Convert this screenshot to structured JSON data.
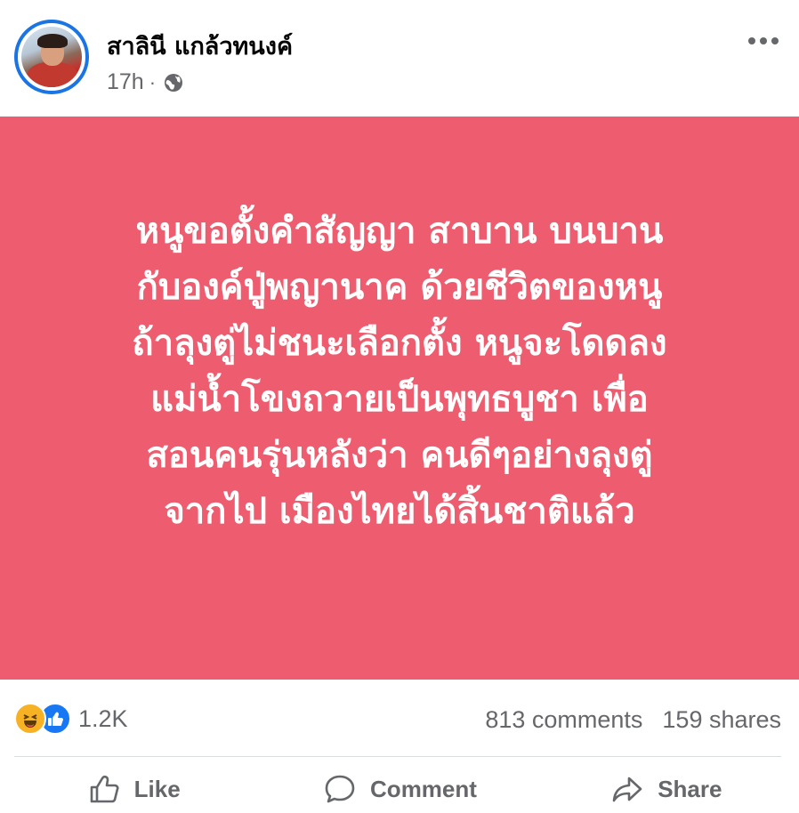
{
  "post": {
    "author": "สาลินี แกล้วทนงค์",
    "time": "17h",
    "separator": "·",
    "privacy_icon": "globe-icon",
    "more_icon": "more-horizontal-icon",
    "background_color": "#ee5d6f",
    "text_color": "#ffffff",
    "text_lines": [
      "หนูขอตั้งคำสัญญา สาบาน บนบาน",
      "กับองค์ปู่พญานาค ด้วยชีวิตของหนู",
      "ถ้าลุงตู่ไม่ชนะเลือกตั้ง หนูจะโดดลง",
      "แม่น้ำโขงถวายเป็นพุทธบูชา เพื่อ",
      "สอนคนรุ่นหลังว่า คนดีๆอย่างลุงตู่",
      "จากไป เมืองไทยได้สิ้นชาติแล้ว"
    ]
  },
  "stats": {
    "reactions": [
      "haha-icon",
      "like-icon"
    ],
    "reaction_count": "1.2K",
    "comments": "813 comments",
    "shares": "159 shares"
  },
  "actions": {
    "like_label": "Like",
    "comment_label": "Comment",
    "share_label": "Share"
  }
}
